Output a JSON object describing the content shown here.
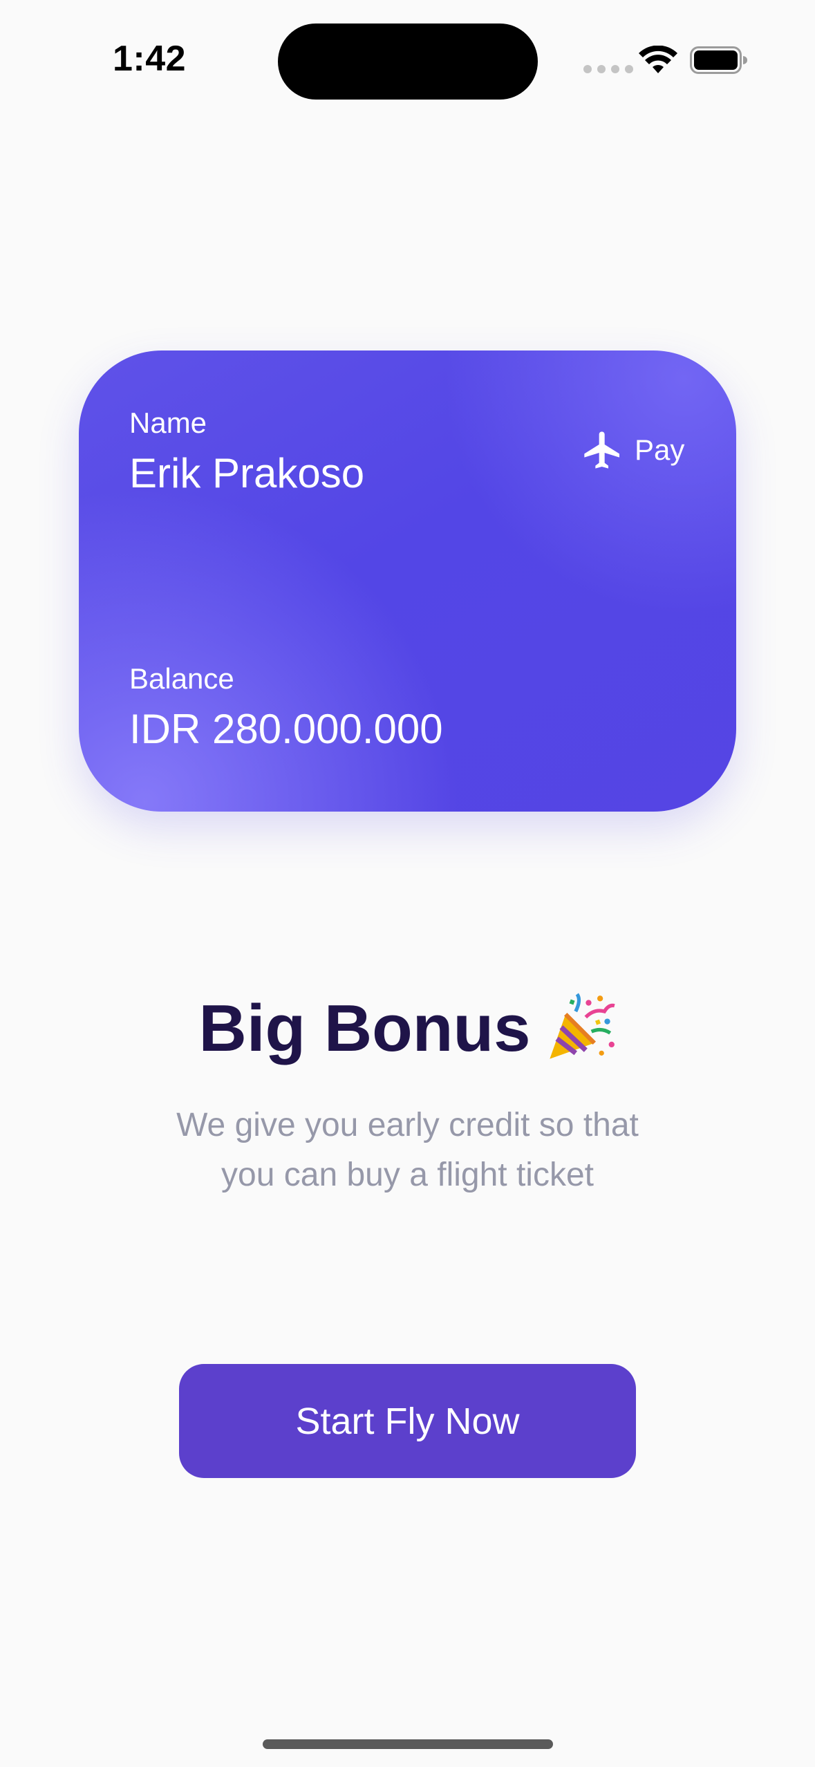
{
  "status_bar": {
    "time": "1:42",
    "icons": [
      "signal-dots-icon",
      "wifi-icon",
      "battery-icon"
    ]
  },
  "card": {
    "name_label": "Name",
    "name_value": "Erik Prakoso",
    "brand_icon": "airplane-icon",
    "brand_label": "Pay",
    "balance_label": "Balance",
    "balance_value": "IDR 280.000.000"
  },
  "bonus": {
    "title": "Big Bonus",
    "title_icon": "party-popper-icon",
    "subtitle_line_1": "We give you early credit so that",
    "subtitle_line_2": "you can buy a flight ticket"
  },
  "actions": {
    "primary_button_label": "Start Fly Now"
  },
  "colors": {
    "card_start": "#5f52e8",
    "card_end": "#5545e4",
    "button": "#5c40cc",
    "title": "#1f1449",
    "subtitle": "#9698a9",
    "background": "#fafafa"
  }
}
